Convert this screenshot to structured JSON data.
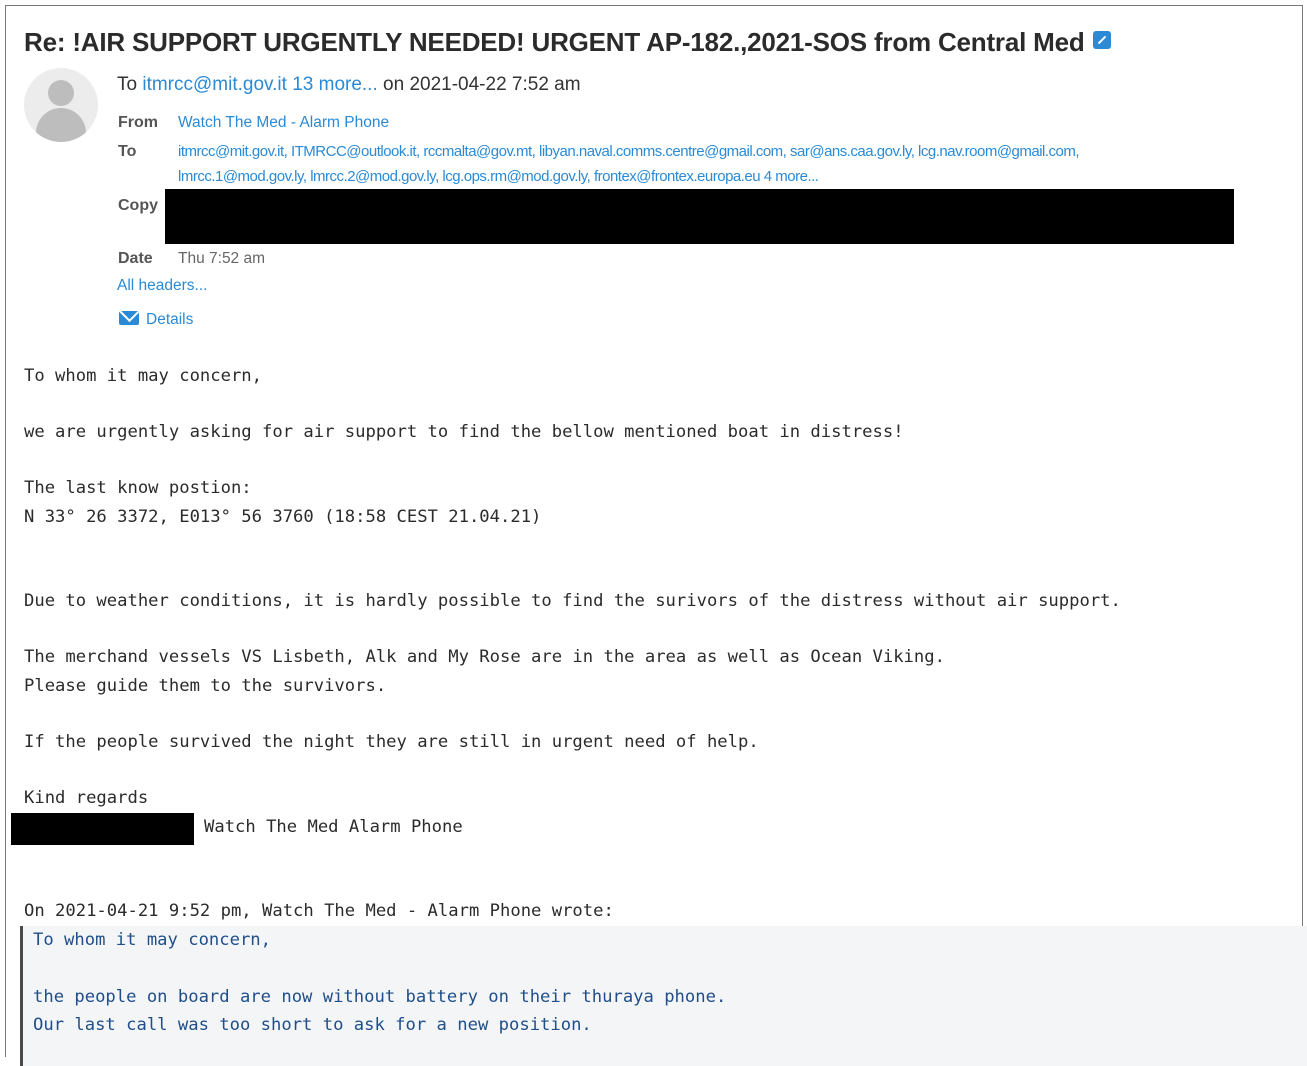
{
  "subject": "Re: !AIR SUPPORT URGENTLY NEEDED! URGENT AP-182.,2021-SOS from Central Med",
  "summary": {
    "to_prefix": "To ",
    "to_address": "itmrcc@mit.gov.it",
    "more_link": "13 more...",
    "date_text": " on 2021-04-22 7:52 am"
  },
  "headers": {
    "from_label": "From",
    "from_value": "Watch The Med - Alarm Phone",
    "to_label": "To",
    "to_line1": "itmrcc@mit.gov.it, ITMRCC@outlook.it, rccmalta@gov.mt, libyan.naval.comms.centre@gmail.com, sar@ans.caa.gov.ly, lcg.nav.room@gmail.com,",
    "to_line2": "lmrcc.1@mod.gov.ly, lmrcc.2@mod.gov.ly, lcg.ops.rm@mod.gov.ly, frontex@frontex.europa.eu 4 more...",
    "copy_label": "Copy",
    "date_label": "Date",
    "date_value": "Thu 7:52 am",
    "all_headers": "All headers...",
    "details": "Details"
  },
  "body": {
    "greeting": "To whom it may concern,",
    "p1": "we are urgently asking for air support to find the bellow mentioned boat in distress!",
    "p2_line1": "The last know postion:",
    "p2_line2": "N 33° 26 3372, E013° 56 3760 (18:58 CEST 21.04.21)",
    "p3": "Due to weather conditions, it is hardly possible to find the surivors of the distress without air support.",
    "p4_line1": "The merchand vessels VS Lisbeth, Alk and My Rose are in the area as well as Ocean Viking.",
    "p4_line2": "Please guide them to the survivors.",
    "p5": "If the people survived the night they are still in urgent need of help.",
    "closing": "Kind regards",
    "signature": "Watch The Med Alarm Phone",
    "quote_intro": "On 2021-04-21 9:52 pm, Watch The Med - Alarm Phone wrote:"
  },
  "quote": {
    "greeting": "To whom it may concern,",
    "line1": "the people on board are now without battery on their thuraya phone.",
    "line2": "Our last call was too short to ask for a new position."
  },
  "colors": {
    "link": "#2a8ad6",
    "redaction": "#000000",
    "quote_text": "#1f4e8a"
  },
  "icons": [
    "external-link-icon",
    "avatar-icon",
    "envelope-icon"
  ]
}
